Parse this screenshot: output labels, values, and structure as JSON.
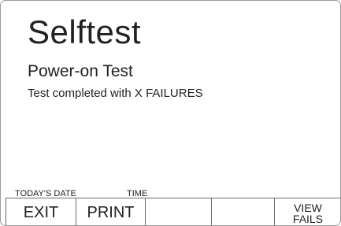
{
  "screen": {
    "title": "Selftest",
    "subtitle": "Power-on Test",
    "message": "Test completed with X FAILURES"
  },
  "status_bar": {
    "date_label": "TODAY'S DATE",
    "time_label": "TIME"
  },
  "softkeys": [
    {
      "label": "EXIT"
    },
    {
      "label": "PRINT"
    },
    {
      "label": ""
    },
    {
      "label": ""
    },
    {
      "label_line1": "VIEW",
      "label_line2": "FAILS"
    }
  ]
}
